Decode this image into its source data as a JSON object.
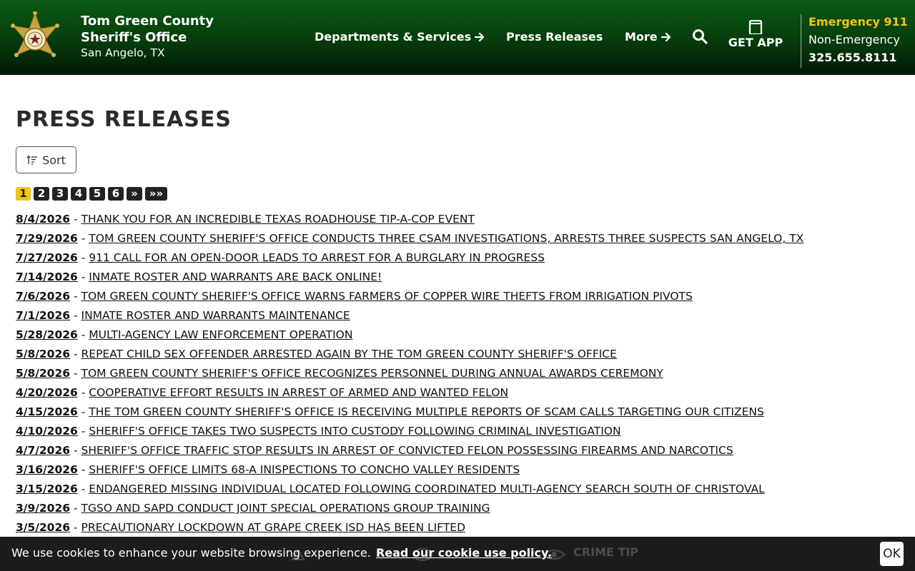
{
  "header": {
    "org_name_line1": "Tom Green County",
    "org_name_line2": "Sheriff's Office",
    "org_location": "San Angelo, TX",
    "nav": [
      {
        "label": "Departments & Services",
        "icon": "arrow-right-icon"
      },
      {
        "label": "Press Releases"
      },
      {
        "label": "More",
        "icon": "arrow-right-icon"
      }
    ],
    "search_icon": "search-icon",
    "get_app_label": "GET APP",
    "emergency_label": "Emergency 911",
    "non_emergency_label": "Non-Emergency",
    "non_emergency_phone": "325.655.8111",
    "accent_color": "#f2c419",
    "header_color": "#063c0c"
  },
  "main": {
    "title": "PRESS RELEASES",
    "sort_label": "Sort",
    "pagination": [
      "1",
      "2",
      "3",
      "4",
      "5",
      "6",
      "»",
      "»»"
    ],
    "current_page": "1",
    "releases": [
      {
        "date": "8/4/2026",
        "title": "THANK YOU FOR AN INCREDIBLE TEXAS ROADHOUSE TIP-A-COP EVENT"
      },
      {
        "date": "7/29/2026",
        "title": "TOM GREEN COUNTY SHERIFF'S OFFICE CONDUCTS THREE CSAM INVESTIGATIONS, ARRESTS THREE SUSPECTS SAN ANGELO, TX"
      },
      {
        "date": "7/27/2026",
        "title": "911 CALL FOR AN OPEN-DOOR LEADS TO ARREST FOR A BURGLARY IN PROGRESS"
      },
      {
        "date": "7/14/2026",
        "title": "INMATE ROSTER AND WARRANTS ARE BACK ONLINE!"
      },
      {
        "date": "7/6/2026",
        "title": "TOM GREEN COUNTY SHERIFF'S OFFICE WARNS FARMERS OF COPPER WIRE THEFTS FROM IRRIGATION PIVOTS"
      },
      {
        "date": "7/1/2026",
        "title": "INMATE ROSTER AND WARRANTS MAINTENANCE"
      },
      {
        "date": "5/28/2026",
        "title": "MULTI-AGENCY LAW ENFORCEMENT OPERATION"
      },
      {
        "date": "5/8/2026",
        "title": "REPEAT CHILD SEX OFFENDER ARRESTED AGAIN BY THE TOM GREEN COUNTY SHERIFF'S OFFICE"
      },
      {
        "date": "5/8/2026",
        "title": "TOM GREEN COUNTY SHERIFF'S OFFICE RECOGNIZES PERSONNEL DURING ANNUAL AWARDS CEREMONY"
      },
      {
        "date": "4/20/2026",
        "title": "COOPERATIVE EFFORT RESULTS IN ARREST OF ARMED AND WANTED FELON"
      },
      {
        "date": "4/15/2026",
        "title": "THE TOM GREEN COUNTY SHERIFF'S OFFICE IS RECEIVING MULTIPLE REPORTS OF SCAM CALLS TARGETING OUR CITIZENS"
      },
      {
        "date": "4/10/2026",
        "title": "SHERIFF'S OFFICE TAKES TWO SUSPECTS INTO CUSTODY FOLLOWING CRIMINAL INVESTIGATION"
      },
      {
        "date": "4/7/2026",
        "title": "SHERIFF'S OFFICE TRAFFIC STOP RESULTS IN ARREST OF CONVICTED FELON POSSESSING FIREARMS AND NARCOTICS"
      },
      {
        "date": "3/16/2026",
        "title": "SHERIFF'S OFFICE LIMITS 68-A INISPECTIONS TO CONCHO VALLEY RESIDENTS"
      },
      {
        "date": "3/15/2026",
        "title": "ENDANGERED MISSING INDIVIDUAL LOCATED FOLLOWING COORDINATED MULTI-AGENCY SEARCH SOUTH OF CHRISTOVAL"
      },
      {
        "date": "3/9/2026",
        "title": "TGSO AND SAPD CONDUCT JOINT SPECIAL OPERATIONS GROUP TRAINING"
      },
      {
        "date": "3/5/2026",
        "title": "PRECAUTIONARY LOCKDOWN AT GRAPE CREEK ISD HAS BEEN LIFTED"
      }
    ]
  },
  "cookie_bar": {
    "message": "We use cookies to enhance your website browsing experience.",
    "link_label": "Read our cookie use policy.",
    "ok_label": "OK",
    "background_label": "CRIME TIP"
  }
}
